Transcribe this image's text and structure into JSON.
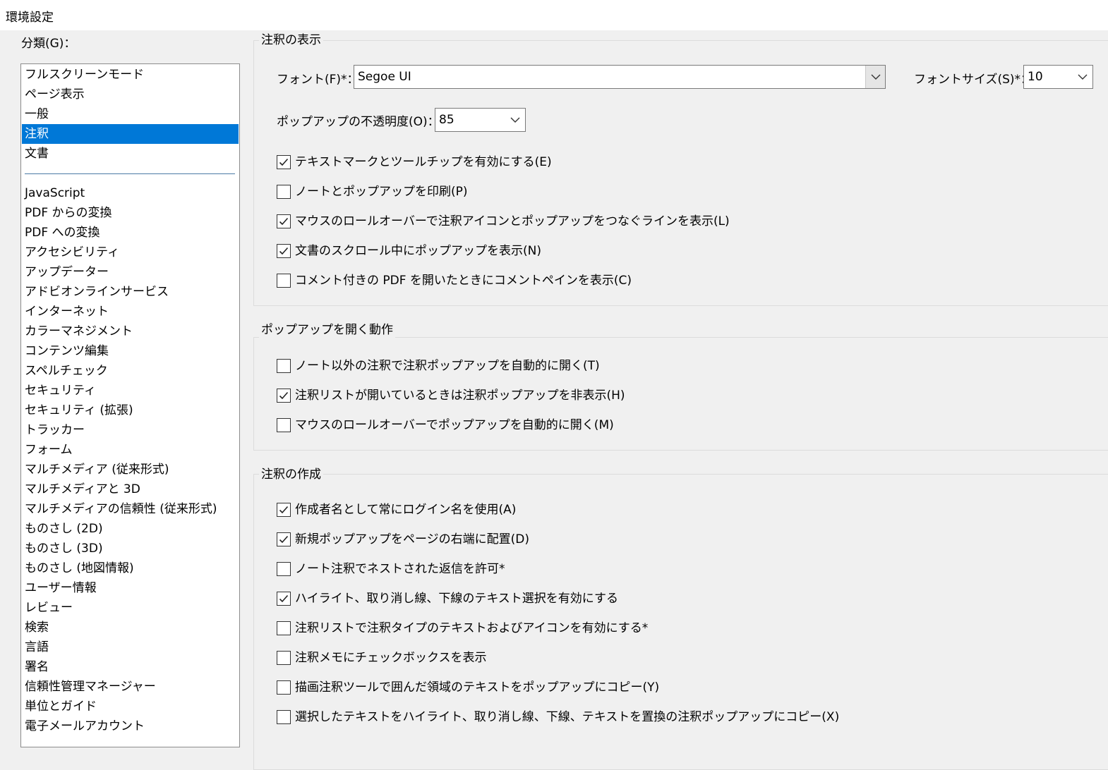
{
  "window": {
    "title": "環境設定"
  },
  "categories": {
    "label": "分類(G)：",
    "top_items": [
      "フルスクリーンモード",
      "ページ表示",
      "一般",
      "注釈",
      "文書"
    ],
    "selected_index": 3,
    "items": [
      "JavaScript",
      "PDF からの変換",
      "PDF への変換",
      "アクセシビリティ",
      "アップデーター",
      "アドビオンラインサービス",
      "インターネット",
      "カラーマネジメント",
      "コンテンツ編集",
      "スペルチェック",
      "セキュリティ",
      "セキュリティ (拡張)",
      "トラッカー",
      "フォーム",
      "マルチメディア (従来形式)",
      "マルチメディアと 3D",
      "マルチメディアの信頼性 (従来形式)",
      "ものさし (2D)",
      "ものさし (3D)",
      "ものさし (地図情報)",
      "ユーザー情報",
      "レビュー",
      "検索",
      "言語",
      "署名",
      "信頼性管理マネージャー",
      "単位とガイド",
      "電子メールアカウント"
    ]
  },
  "display": {
    "title": "注釈の表示",
    "font_label": "フォント(F)*：",
    "font_value": "Segoe UI",
    "font_size_label": "フォントサイズ(S)*：",
    "font_size_value": "10",
    "opacity_label": "ポップアップの不透明度(O)：",
    "opacity_value": "85",
    "checkboxes": [
      {
        "label": "テキストマークとツールチップを有効にする(E)",
        "checked": true
      },
      {
        "label": "ノートとポップアップを印刷(P)",
        "checked": false
      },
      {
        "label": "マウスのロールオーバーで注釈アイコンとポップアップをつなぐラインを表示(L)",
        "checked": true
      },
      {
        "label": "文書のスクロール中にポップアップを表示(N)",
        "checked": true
      },
      {
        "label": "コメント付きの PDF を開いたときにコメントペインを表示(C)",
        "checked": false
      }
    ]
  },
  "popup": {
    "title": "ポップアップを開く動作",
    "checkboxes": [
      {
        "label": "ノート以外の注釈で注釈ポップアップを自動的に開く(T)",
        "checked": false
      },
      {
        "label": "注釈リストが開いているときは注釈ポップアップを非表示(H)",
        "checked": true
      },
      {
        "label": "マウスのロールオーバーでポップアップを自動的に開く(M)",
        "checked": false
      }
    ]
  },
  "create": {
    "title": "注釈の作成",
    "checkboxes": [
      {
        "label": "作成者名として常にログイン名を使用(A)",
        "checked": true
      },
      {
        "label": "新規ポップアップをページの右端に配置(D)",
        "checked": true
      },
      {
        "label": "ノート注釈でネストされた返信を許可*",
        "checked": false
      },
      {
        "label": "ハイライト、取り消し線、下線のテキスト選択を有効にする",
        "checked": true
      },
      {
        "label": "注釈リストで注釈タイプのテキストおよびアイコンを有効にする*",
        "checked": false
      },
      {
        "label": "注釈メモにチェックボックスを表示",
        "checked": false
      },
      {
        "label": "描画注釈ツールで囲んだ領域のテキストをポップアップにコピー(Y)",
        "checked": false
      },
      {
        "label": "選択したテキストをハイライト、取り消し線、下線、テキストを置換の注釈ポップアップにコピー(X)",
        "checked": false
      }
    ]
  },
  "icons": {
    "dropdown": "chevron-down-icon",
    "check": "checkmark-icon"
  }
}
